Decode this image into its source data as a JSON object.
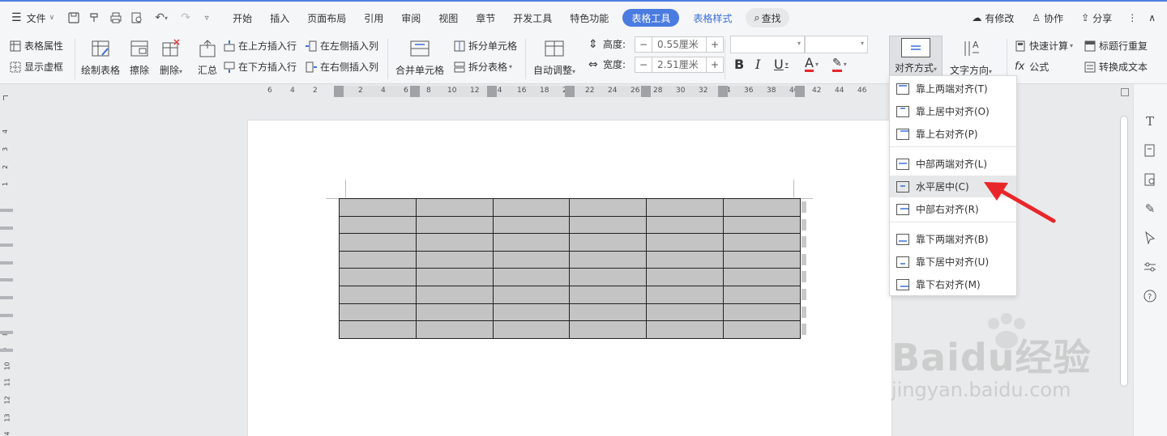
{
  "menubar": {
    "file_label": "文件",
    "tabs": [
      "开始",
      "插入",
      "页面布局",
      "引用",
      "审阅",
      "视图",
      "章节",
      "开发工具",
      "特色功能"
    ],
    "active_tab": "表格工具",
    "table_style_tab": "表格样式",
    "search_label": "查找",
    "changes_label": "有修改",
    "collab_label": "协作",
    "share_label": "分享"
  },
  "toolbar": {
    "table_props": "表格属性",
    "show_gridlines": "显示虚框",
    "draw_table": "绘制表格",
    "erase": "擦除",
    "delete": "删除",
    "summary": "汇总",
    "insert_row_above": "在上方插入行",
    "insert_row_below": "在下方插入行",
    "insert_col_left": "在左侧插入列",
    "insert_col_right": "在右侧插入列",
    "merge_cells": "合并单元格",
    "split_cells": "拆分单元格",
    "split_table": "拆分表格",
    "auto_adjust": "自动调整",
    "height_label": "高度:",
    "height_value": "0.55厘米",
    "width_label": "宽度:",
    "width_value": "2.51厘米",
    "align_label": "对齐方式",
    "text_dir_label": "文字方向",
    "quick_calc": "快速计算",
    "formula": "公式",
    "repeat_header": "标题行重复",
    "convert_text": "转换成文本"
  },
  "ruler": {
    "numbers": [
      "6",
      "4",
      "2",
      "2",
      "4",
      "6",
      "8",
      "10",
      "12",
      "14",
      "16",
      "18",
      "20",
      "22",
      "24",
      "26",
      "28",
      "30",
      "32",
      "34",
      "36",
      "38",
      "40",
      "42",
      "44",
      "46"
    ]
  },
  "vruler": {
    "numbers": [
      "4",
      "3",
      "2",
      "1",
      "8",
      "9",
      "10",
      "11",
      "12",
      "13",
      "14"
    ]
  },
  "table": {
    "rows": 8,
    "cols": 6
  },
  "dropdown": {
    "items": [
      {
        "label": "靠上两端对齐(T)",
        "name": "align-top-justify"
      },
      {
        "label": "靠上居中对齐(O)",
        "name": "align-top-center"
      },
      {
        "label": "靠上右对齐(P)",
        "name": "align-top-right"
      },
      {
        "label": "中部两端对齐(L)",
        "name": "align-middle-justify"
      },
      {
        "label": "水平居中(C)",
        "name": "align-middle-center"
      },
      {
        "label": "中部右对齐(R)",
        "name": "align-middle-right"
      },
      {
        "label": "靠下两端对齐(B)",
        "name": "align-bottom-justify"
      },
      {
        "label": "靠下居中对齐(U)",
        "name": "align-bottom-center"
      },
      {
        "label": "靠下右对齐(M)",
        "name": "align-bottom-right"
      }
    ],
    "active_label": "水平居中(C)"
  },
  "watermark": {
    "brand": "Baidu经验",
    "url": "jingyan.baidu.com"
  },
  "colors": {
    "accent": "#4a7be0",
    "arrow": "#e8262a",
    "cell_fill": "#c4c4c4"
  }
}
